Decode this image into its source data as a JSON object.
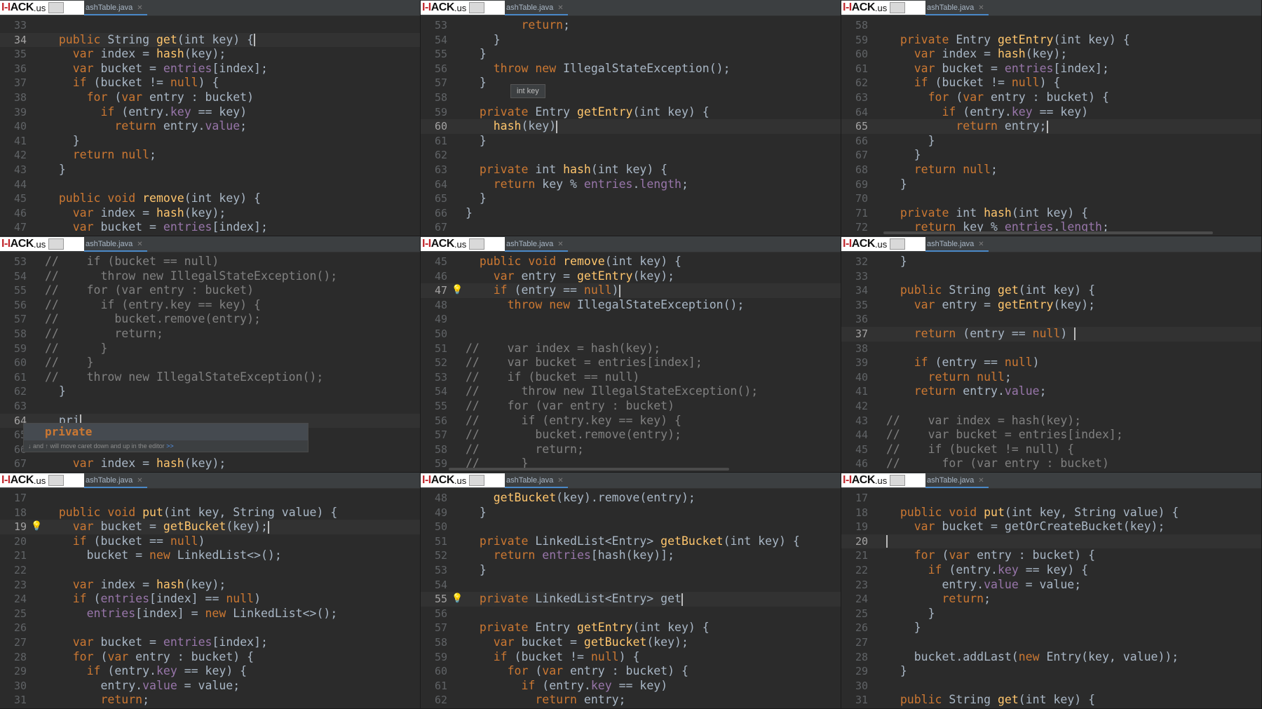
{
  "brand": {
    "mark": "I-I",
    "name": "ACK",
    "tld": ".us"
  },
  "panels": [
    {
      "tab": "ashTable.java",
      "lines": [
        {
          "n": "33",
          "t": ""
        },
        {
          "n": "34",
          "t": "  public String get(int key) {",
          "cur": true
        },
        {
          "n": "35",
          "t": "    var index = hash(key);"
        },
        {
          "n": "36",
          "t": "    var bucket = entries[index];"
        },
        {
          "n": "37",
          "t": "    if (bucket != null) {"
        },
        {
          "n": "38",
          "t": "      for (var entry : bucket)"
        },
        {
          "n": "39",
          "t": "        if (entry.key == key)"
        },
        {
          "n": "40",
          "t": "          return entry.value;"
        },
        {
          "n": "41",
          "t": "    }"
        },
        {
          "n": "42",
          "t": "    return null;"
        },
        {
          "n": "43",
          "t": "  }"
        },
        {
          "n": "44",
          "t": ""
        },
        {
          "n": "45",
          "t": "  public void remove(int key) {"
        },
        {
          "n": "46",
          "t": "    var index = hash(key);"
        },
        {
          "n": "47",
          "t": "    var bucket = entries[index];"
        }
      ]
    },
    {
      "tab": "ashTable.java",
      "tooltip": "int key",
      "lines": [
        {
          "n": "53",
          "t": "        return;"
        },
        {
          "n": "54",
          "t": "    }"
        },
        {
          "n": "55",
          "t": "  }"
        },
        {
          "n": "56",
          "t": "    throw new IllegalStateException();"
        },
        {
          "n": "57",
          "t": "  }"
        },
        {
          "n": "58",
          "t": ""
        },
        {
          "n": "59",
          "t": "  private Entry getEntry(int key) {"
        },
        {
          "n": "60",
          "t": "    hash(key)",
          "cur": true
        },
        {
          "n": "61",
          "t": "  }"
        },
        {
          "n": "62",
          "t": ""
        },
        {
          "n": "63",
          "t": "  private int hash(int key) {"
        },
        {
          "n": "64",
          "t": "    return key % entries.length;"
        },
        {
          "n": "65",
          "t": "  }"
        },
        {
          "n": "66",
          "t": "}"
        },
        {
          "n": "67",
          "t": ""
        }
      ]
    },
    {
      "tab": "ashTable.java",
      "lines": [
        {
          "n": "58",
          "t": ""
        },
        {
          "n": "59",
          "t": "  private Entry getEntry(int key) {"
        },
        {
          "n": "60",
          "t": "    var index = hash(key);"
        },
        {
          "n": "61",
          "t": "    var bucket = entries[index];"
        },
        {
          "n": "62",
          "t": "    if (bucket != null) {"
        },
        {
          "n": "63",
          "t": "      for (var entry : bucket) {"
        },
        {
          "n": "64",
          "t": "        if (entry.key == key)"
        },
        {
          "n": "65",
          "t": "          return entry;",
          "cur": true
        },
        {
          "n": "66",
          "t": "      }"
        },
        {
          "n": "67",
          "t": "    }"
        },
        {
          "n": "68",
          "t": "    return null;"
        },
        {
          "n": "69",
          "t": "  }"
        },
        {
          "n": "70",
          "t": ""
        },
        {
          "n": "71",
          "t": "  private int hash(int key) {"
        },
        {
          "n": "72",
          "t": "    return key % entries.length;"
        }
      ]
    },
    {
      "tab": "ashTable.java",
      "popup": {
        "item": "private",
        "hint": "↓ and ↑ will move caret down and up in the editor",
        "hint_link": ">>"
      },
      "lines": [
        {
          "n": "53",
          "t": "//    if (bucket == null)"
        },
        {
          "n": "54",
          "t": "//      throw new IllegalStateException();"
        },
        {
          "n": "55",
          "t": "//    for (var entry : bucket)"
        },
        {
          "n": "56",
          "t": "//      if (entry.key == key) {"
        },
        {
          "n": "57",
          "t": "//        bucket.remove(entry);"
        },
        {
          "n": "58",
          "t": "//        return;"
        },
        {
          "n": "59",
          "t": "//      }"
        },
        {
          "n": "60",
          "t": "//    }"
        },
        {
          "n": "61",
          "t": "//    throw new IllegalStateException();"
        },
        {
          "n": "62",
          "t": "  }"
        },
        {
          "n": "63",
          "t": ""
        },
        {
          "n": "64",
          "t": "  pri",
          "cur": true
        },
        {
          "n": "65",
          "t": ""
        },
        {
          "n": "66",
          "t": ""
        },
        {
          "n": "67",
          "t": "    var index = hash(key);"
        }
      ]
    },
    {
      "tab": "ashTable.java",
      "lines": [
        {
          "n": "45",
          "t": "  public void remove(int key) {"
        },
        {
          "n": "46",
          "t": "    var entry = getEntry(key);"
        },
        {
          "n": "47",
          "t": "    if (entry == null)",
          "cur": true
        },
        {
          "n": "48",
          "t": "      throw new IllegalStateException();"
        },
        {
          "n": "49",
          "t": ""
        },
        {
          "n": "50",
          "t": ""
        },
        {
          "n": "51",
          "t": "//    var index = hash(key);"
        },
        {
          "n": "52",
          "t": "//    var bucket = entries[index];"
        },
        {
          "n": "53",
          "t": "//    if (bucket == null)"
        },
        {
          "n": "54",
          "t": "//      throw new IllegalStateException();"
        },
        {
          "n": "55",
          "t": "//    for (var entry : bucket)"
        },
        {
          "n": "56",
          "t": "//      if (entry.key == key) {"
        },
        {
          "n": "57",
          "t": "//        bucket.remove(entry);"
        },
        {
          "n": "58",
          "t": "//        return;"
        },
        {
          "n": "59",
          "t": "//      }"
        }
      ]
    },
    {
      "tab": "ashTable.java",
      "lines": [
        {
          "n": "32",
          "t": "  }"
        },
        {
          "n": "33",
          "t": ""
        },
        {
          "n": "34",
          "t": "  public String get(int key) {"
        },
        {
          "n": "35",
          "t": "    var entry = getEntry(key);"
        },
        {
          "n": "36",
          "t": ""
        },
        {
          "n": "37",
          "t": "    return (entry == null) ",
          "cur": true
        },
        {
          "n": "38",
          "t": ""
        },
        {
          "n": "39",
          "t": "    if (entry == null)"
        },
        {
          "n": "40",
          "t": "      return null;"
        },
        {
          "n": "41",
          "t": "    return entry.value;"
        },
        {
          "n": "42",
          "t": ""
        },
        {
          "n": "43",
          "t": "//    var index = hash(key);"
        },
        {
          "n": "44",
          "t": "//    var bucket = entries[index];"
        },
        {
          "n": "45",
          "t": "//    if (bucket != null) {"
        },
        {
          "n": "46",
          "t": "//      for (var entry : bucket)"
        }
      ]
    },
    {
      "tab": "ashTable.java",
      "lines": [
        {
          "n": "17",
          "t": ""
        },
        {
          "n": "18",
          "t": "  public void put(int key, String value) {"
        },
        {
          "n": "19",
          "t": "    var bucket = getBucket(key);",
          "cur": true
        },
        {
          "n": "20",
          "t": "    if (bucket == null)"
        },
        {
          "n": "21",
          "t": "      bucket = new LinkedList<>();"
        },
        {
          "n": "22",
          "t": ""
        },
        {
          "n": "23",
          "t": "    var index = hash(key);"
        },
        {
          "n": "24",
          "t": "    if (entries[index] == null)"
        },
        {
          "n": "25",
          "t": "      entries[index] = new LinkedList<>();"
        },
        {
          "n": "26",
          "t": ""
        },
        {
          "n": "27",
          "t": "    var bucket = entries[index];"
        },
        {
          "n": "28",
          "t": "    for (var entry : bucket) {"
        },
        {
          "n": "29",
          "t": "      if (entry.key == key) {"
        },
        {
          "n": "30",
          "t": "        entry.value = value;"
        },
        {
          "n": "31",
          "t": "        return;"
        }
      ]
    },
    {
      "tab": "ashTable.java",
      "lines": [
        {
          "n": "48",
          "t": "    getBucket(key).remove(entry);"
        },
        {
          "n": "49",
          "t": "  }"
        },
        {
          "n": "50",
          "t": ""
        },
        {
          "n": "51",
          "t": "  private LinkedList<Entry> getBucket(int key) {"
        },
        {
          "n": "52",
          "t": "    return entries[hash(key)];"
        },
        {
          "n": "53",
          "t": "  }"
        },
        {
          "n": "54",
          "t": ""
        },
        {
          "n": "55",
          "t": "  private LinkedList<Entry> get",
          "cur": true
        },
        {
          "n": "56",
          "t": ""
        },
        {
          "n": "57",
          "t": "  private Entry getEntry(int key) {"
        },
        {
          "n": "58",
          "t": "    var bucket = getBucket(key);"
        },
        {
          "n": "59",
          "t": "    if (bucket != null) {"
        },
        {
          "n": "60",
          "t": "      for (var entry : bucket) {"
        },
        {
          "n": "61",
          "t": "        if (entry.key == key)"
        },
        {
          "n": "62",
          "t": "          return entry;"
        }
      ]
    },
    {
      "tab": "ashTable.java",
      "lines": [
        {
          "n": "17",
          "t": ""
        },
        {
          "n": "18",
          "t": "  public void put(int key, String value) {"
        },
        {
          "n": "19",
          "t": "    var bucket = getOrCreateBucket(key);"
        },
        {
          "n": "20",
          "t": "",
          "cur": true
        },
        {
          "n": "21",
          "t": "    for (var entry : bucket) {"
        },
        {
          "n": "22",
          "t": "      if (entry.key == key) {"
        },
        {
          "n": "23",
          "t": "        entry.value = value;"
        },
        {
          "n": "24",
          "t": "        return;"
        },
        {
          "n": "25",
          "t": "      }"
        },
        {
          "n": "26",
          "t": "    }"
        },
        {
          "n": "27",
          "t": ""
        },
        {
          "n": "28",
          "t": "    bucket.addLast(new Entry(key, value));"
        },
        {
          "n": "29",
          "t": "  }"
        },
        {
          "n": "30",
          "t": ""
        },
        {
          "n": "31",
          "t": "  public String get(int key) {"
        }
      ]
    }
  ]
}
